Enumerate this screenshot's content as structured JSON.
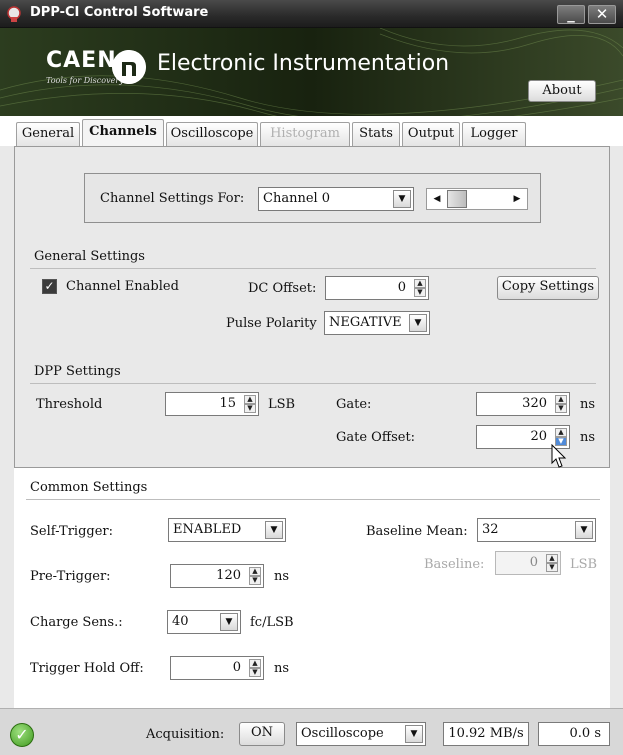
{
  "window": {
    "title": "DPP-CI Control Software",
    "minimize_glyph": "_",
    "close_glyph": "✕"
  },
  "banner": {
    "logo_text": "CAEN",
    "logo_tagline": "Tools for Discovery",
    "title": "Electronic Instrumentation",
    "about_label": "About"
  },
  "tabs": [
    {
      "label": "General",
      "state": "normal"
    },
    {
      "label": "Channels",
      "state": "active"
    },
    {
      "label": "Oscilloscope",
      "state": "normal"
    },
    {
      "label": "Histogram",
      "state": "disabled"
    },
    {
      "label": "Stats",
      "state": "normal"
    },
    {
      "label": "Output",
      "state": "normal"
    },
    {
      "label": "Logger",
      "state": "normal"
    }
  ],
  "channel_select": {
    "label": "Channel Settings For:",
    "value": "Channel 0"
  },
  "general_settings": {
    "title": "General Settings",
    "channel_enabled_label": "Channel Enabled",
    "channel_enabled": true,
    "dc_offset_label": "DC Offset:",
    "dc_offset_value": "0",
    "copy_settings_label": "Copy Settings",
    "pulse_polarity_label": "Pulse Polarity",
    "pulse_polarity_value": "NEGATIVE"
  },
  "dpp_settings": {
    "title": "DPP Settings",
    "threshold_label": "Threshold",
    "threshold_value": "15",
    "threshold_unit": "LSB",
    "gate_label": "Gate:",
    "gate_value": "320",
    "gate_unit": "ns",
    "gate_offset_label": "Gate Offset:",
    "gate_offset_value": "20",
    "gate_offset_unit": "ns"
  },
  "common_settings": {
    "title": "Common Settings",
    "self_trigger_label": "Self-Trigger:",
    "self_trigger_value": "ENABLED",
    "baseline_mean_label": "Baseline Mean:",
    "baseline_mean_value": "32",
    "baseline_label": "Baseline:",
    "baseline_value": "0",
    "baseline_unit": "LSB",
    "pre_trigger_label": "Pre-Trigger:",
    "pre_trigger_value": "120",
    "pre_trigger_unit": "ns",
    "charge_sens_label": "Charge Sens.:",
    "charge_sens_value": "40",
    "charge_sens_unit": "fc/LSB",
    "trigger_hold_off_label": "Trigger Hold Off:",
    "trigger_hold_off_value": "0",
    "trigger_hold_off_unit": "ns"
  },
  "status": {
    "acquisition_label": "Acquisition:",
    "acquisition_button": "ON",
    "mode_value": "Oscilloscope",
    "rate": "10.92 MB/s",
    "time": "0.0 s"
  }
}
